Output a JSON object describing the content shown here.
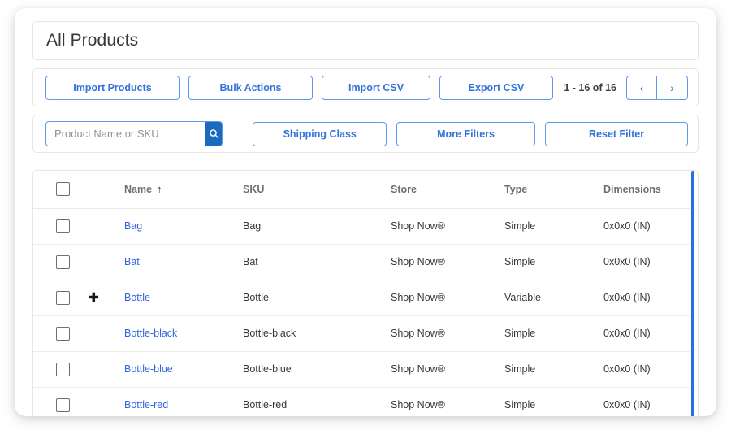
{
  "header": {
    "title": "All Products"
  },
  "toolbar": {
    "import_products_label": "Import Products",
    "bulk_actions_label": "Bulk Actions",
    "import_csv_label": "Import CSV",
    "export_csv_label": "Export CSV",
    "pagination": {
      "range_label": "1 - 16 of 16",
      "prev_icon": "chevron-left-icon",
      "prev_glyph": "‹",
      "next_icon": "chevron-right-icon",
      "next_glyph": "›"
    }
  },
  "filters": {
    "search_placeholder": "Product Name or SKU",
    "search_value": "",
    "search_icon": "search-icon",
    "shipping_class_label": "Shipping Class",
    "more_filters_label": "More Filters",
    "reset_filter_label": "Reset Filter"
  },
  "table": {
    "columns": {
      "name": "Name",
      "sku": "SKU",
      "store": "Store",
      "type": "Type",
      "dimensions": "Dimensions"
    },
    "sort": {
      "column": "Name",
      "direction_glyph": "↑",
      "icon": "sort-ascending-icon"
    },
    "select_all_checkbox": false,
    "rows": [
      {
        "name": "Bag",
        "sku": "Bag",
        "store": "Shop Now®",
        "type": "Simple",
        "dimensions": "0x0x0 (IN)",
        "expandable": false,
        "expander_glyph": ""
      },
      {
        "name": "Bat",
        "sku": "Bat",
        "store": "Shop Now®",
        "type": "Simple",
        "dimensions": "0x0x0 (IN)",
        "expandable": false,
        "expander_glyph": ""
      },
      {
        "name": "Bottle",
        "sku": "Bottle",
        "store": "Shop Now®",
        "type": "Variable",
        "dimensions": "0x0x0 (IN)",
        "expandable": true,
        "expander_glyph": "✚"
      },
      {
        "name": "Bottle-black",
        "sku": "Bottle-black",
        "store": "Shop Now®",
        "type": "Simple",
        "dimensions": "0x0x0 (IN)",
        "expandable": false,
        "expander_glyph": ""
      },
      {
        "name": "Bottle-blue",
        "sku": "Bottle-blue",
        "store": "Shop Now®",
        "type": "Simple",
        "dimensions": "0x0x0 (IN)",
        "expandable": false,
        "expander_glyph": ""
      },
      {
        "name": "Bottle-red",
        "sku": "Bottle-red",
        "store": "Shop Now®",
        "type": "Simple",
        "dimensions": "0x0x0 (IN)",
        "expandable": false,
        "expander_glyph": ""
      }
    ]
  },
  "colors": {
    "link_blue": "#3265e0",
    "button_blue": "#3273dc",
    "button_border_blue": "#5b9bea",
    "search_button_blue": "#1a6bbd",
    "scrollbar_blue": "#2a6fdb",
    "text_dark": "#34383d",
    "text_muted": "#6c7075",
    "panel_border": "#e6e6e6"
  }
}
